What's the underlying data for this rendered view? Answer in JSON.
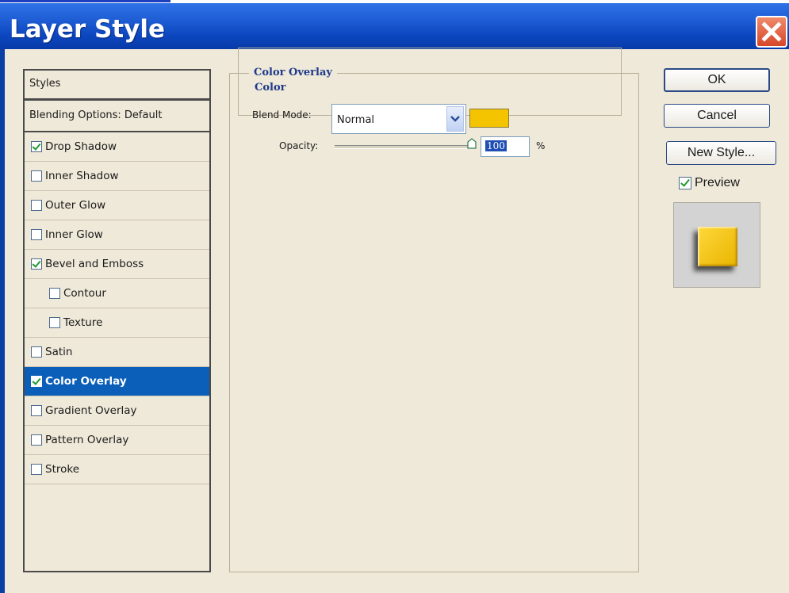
{
  "window": {
    "title": "Layer Style"
  },
  "styles_panel": {
    "header": "Styles",
    "blending_options": "Blending Options: Default",
    "items": [
      {
        "label": "Drop Shadow",
        "checked": true,
        "selected": false,
        "indent": false
      },
      {
        "label": "Inner Shadow",
        "checked": false,
        "selected": false,
        "indent": false
      },
      {
        "label": "Outer Glow",
        "checked": false,
        "selected": false,
        "indent": false
      },
      {
        "label": "Inner Glow",
        "checked": false,
        "selected": false,
        "indent": false
      },
      {
        "label": "Bevel and Emboss",
        "checked": true,
        "selected": false,
        "indent": false
      },
      {
        "label": "Contour",
        "checked": false,
        "selected": false,
        "indent": true
      },
      {
        "label": "Texture",
        "checked": false,
        "selected": false,
        "indent": true
      },
      {
        "label": "Satin",
        "checked": false,
        "selected": false,
        "indent": false
      },
      {
        "label": "Color Overlay",
        "checked": true,
        "selected": true,
        "indent": false
      },
      {
        "label": "Gradient Overlay",
        "checked": false,
        "selected": false,
        "indent": false
      },
      {
        "label": "Pattern Overlay",
        "checked": false,
        "selected": false,
        "indent": false
      },
      {
        "label": "Stroke",
        "checked": false,
        "selected": false,
        "indent": false
      }
    ]
  },
  "color_overlay": {
    "group_title": "Color Overlay",
    "sub_title": "Color",
    "blend_mode_label": "Blend Mode:",
    "blend_mode_value": "Normal",
    "overlay_color": "#f5c400",
    "opacity_label": "Opacity:",
    "opacity_value": "100",
    "opacity_unit": "%",
    "opacity_level": 1.0
  },
  "buttons": {
    "ok": "OK",
    "cancel": "Cancel",
    "new_style": "New Style...",
    "preview_label": "Preview",
    "preview_checked": true
  },
  "colors": {
    "titlebar": "#1f5ed6",
    "dialog_background": "#efe9d9",
    "selection": "#0b5fb8",
    "close_button": "#d6472a"
  }
}
